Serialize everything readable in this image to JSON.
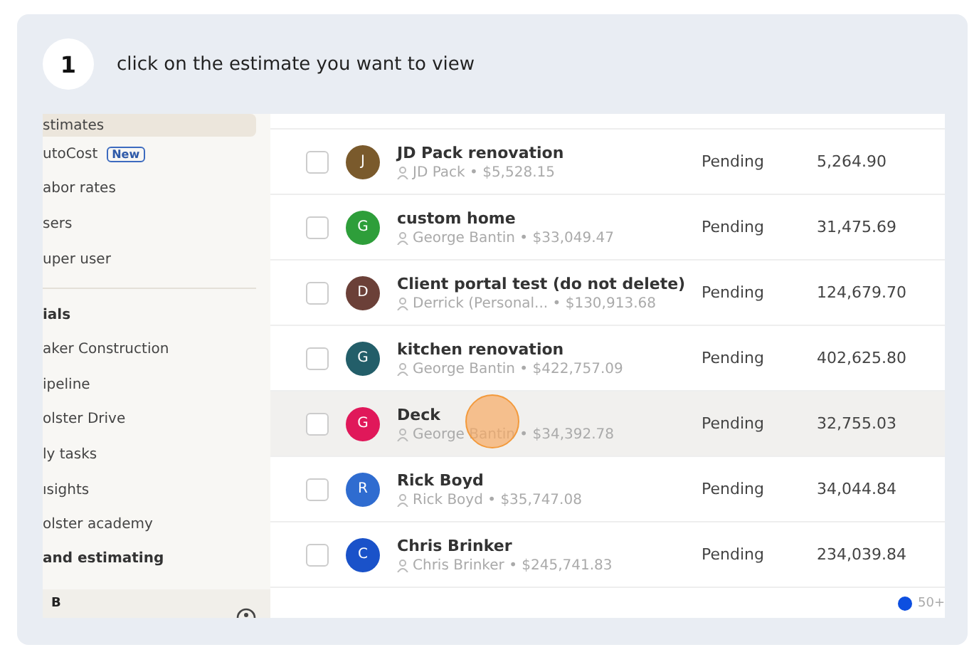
{
  "step": {
    "number": "1",
    "instruction": "click on the estimate you want to view"
  },
  "sidebar": {
    "items": [
      {
        "label": "stimates",
        "selected": true
      },
      {
        "label": "utoCost",
        "selected": false,
        "badge": "New"
      },
      {
        "label": "abor rates",
        "selected": false
      },
      {
        "label": "sers",
        "selected": false
      },
      {
        "label": "uper user",
        "selected": false
      }
    ],
    "section_title": "ials",
    "section_items": [
      {
        "label": "aker Construction"
      },
      {
        "label": "ipeline"
      },
      {
        "label": "olster Drive"
      },
      {
        "label": "ly tasks"
      },
      {
        "label": "ısights"
      },
      {
        "label": "olster academy"
      }
    ],
    "footer_heading": "and estimating",
    "account_initial": "B"
  },
  "rows": [
    {
      "initial": "J",
      "color": "#7a5a2c",
      "title": "JD Pack renovation",
      "subtitle": "JD Pack • $5,528.15",
      "status": "Pending",
      "total": "5,264.90",
      "selected": false
    },
    {
      "initial": "G",
      "color": "#2e9e3a",
      "title": "custom home",
      "subtitle": "George Bantin • $33,049.47",
      "status": "Pending",
      "total": "31,475.69",
      "selected": false
    },
    {
      "initial": "D",
      "color": "#6b4038",
      "title": "Client portal test (do not delete)",
      "subtitle": "Derrick (Personal... • $130,913.68",
      "status": "Pending",
      "total": "124,679.70",
      "selected": false
    },
    {
      "initial": "G",
      "color": "#235e69",
      "title": "kitchen renovation",
      "subtitle": "George Bantin • $422,757.09",
      "status": "Pending",
      "total": "402,625.80",
      "selected": false
    },
    {
      "initial": "G",
      "color": "#e0185a",
      "title": "Deck",
      "subtitle": "George Bantin • $34,392.78",
      "status": "Pending",
      "total": "32,755.03",
      "selected": true
    },
    {
      "initial": "R",
      "color": "#2f6cd0",
      "title": "Rick Boyd",
      "subtitle": "Rick Boyd • $35,747.08",
      "status": "Pending",
      "total": "34,044.84",
      "selected": false
    },
    {
      "initial": "C",
      "color": "#1a52c9",
      "title": "Chris Brinker",
      "subtitle": "Chris Brinker • $245,741.83",
      "status": "Pending",
      "total": "234,039.84",
      "selected": false
    }
  ],
  "footer": {
    "count": "50+"
  }
}
